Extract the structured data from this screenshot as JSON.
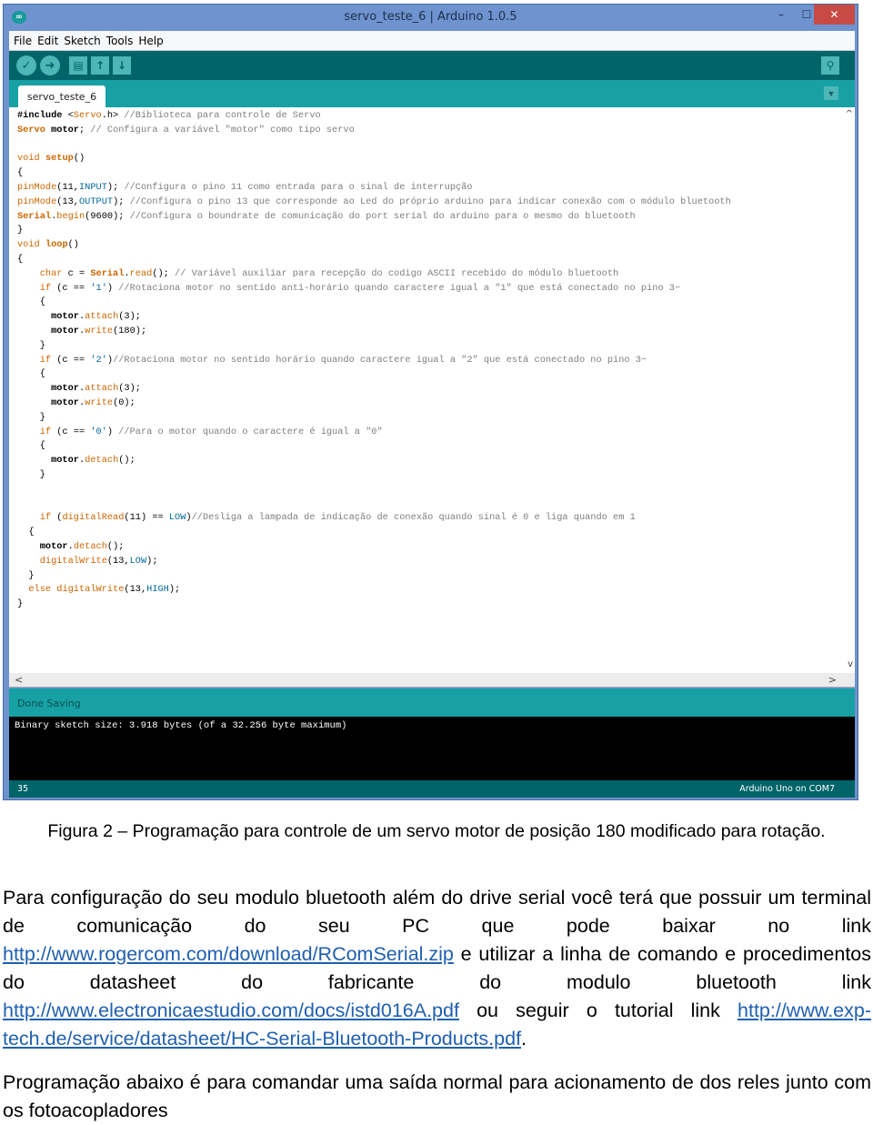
{
  "window": {
    "title": "servo_teste_6 | Arduino 1.0.5",
    "logo_glyph": "∞",
    "controls": {
      "minimize": "–",
      "maximize": "☐",
      "close": "✕"
    }
  },
  "menubar": {
    "items": [
      "File",
      "Edit",
      "Sketch",
      "Tools",
      "Help"
    ]
  },
  "toolbar": {
    "buttons": [
      {
        "name": "verify",
        "glyph": "✓"
      },
      {
        "name": "upload",
        "glyph": "➜"
      },
      {
        "name": "new",
        "glyph": "▤"
      },
      {
        "name": "open",
        "glyph": "↑"
      },
      {
        "name": "save",
        "glyph": "↓"
      }
    ],
    "serial_monitor_glyph": "⚲"
  },
  "tabs": {
    "active": "servo_teste_6",
    "menu_glyph": "▼"
  },
  "editor": {
    "code_lines": [
      "#include <Servo.h> //Biblioteca para controle de Servo",
      "Servo motor; // Configura a variável \"motor\" como tipo servo",
      "",
      "void setup()",
      "{",
      "pinMode(11,INPUT); //Configura o pino 11 como entrada para o sinal de interrupção",
      "pinMode(13,OUTPUT); //Configura o pino 13 que corresponde ao Led do próprio arduino para indicar conexão com o módulo bluetooth",
      "Serial.begin(9600); //Configura o boundrate de comunicação do port serial do arduino para o mesmo do bluetooth",
      "}",
      "void loop()",
      "{",
      "    char c = Serial.read(); // Variável auxiliar para recepção do codigo ASCII recebido do módulo bluetooth",
      "    if (c == '1') //Rotaciona motor no sentido anti-horário quando caractere igual a \"1\" que está conectado no pino 3~",
      "    {",
      "      motor.attach(3);",
      "      motor.write(180);",
      "    }",
      "    if (c == '2')//Rotaciona motor no sentido horário quando caractere igual a \"2\" que está conectado no pino 3~",
      "    {",
      "      motor.attach(3);",
      "      motor.write(0);",
      "    }",
      "    if (c == '0') //Para o motor quando o caractere é igual a \"0\"",
      "    {",
      "      motor.detach();",
      "    }",
      "",
      "",
      "    if (digitalRead(11) == LOW)//Desliga a lampada de indicação de conexão quando sinal é 0 e liga quando em 1",
      "  {",
      "    motor.detach();",
      "    digitalWrite(13,LOW);",
      "  }",
      "  else digitalWrite(13,HIGH);",
      "}"
    ],
    "scroll_up": "^",
    "scroll_down": "v",
    "scroll_left": "<",
    "scroll_right": ">"
  },
  "status": {
    "message": "Done Saving"
  },
  "console": {
    "output": "Binary sketch size: 3.918 bytes (of a 32.256 byte maximum)"
  },
  "footer": {
    "line_number": "35",
    "board": "Arduino Uno on COM7"
  },
  "document": {
    "caption": "Figura 2 – Programação para controle de um servo motor de posição 180 modificado para rotação.",
    "paragraph1": {
      "text_a": "Para configuração do seu modulo bluetooth além do drive serial você terá que possuir um terminal de comunicação do seu PC que pode baixar no link ",
      "link1": "http://www.rogercom.com/download/RComSerial.zip",
      "text_b": " e utilizar a linha de comando e procedimentos do datasheet do fabricante do modulo bluetooth link ",
      "link2": "http://www.electronicaestudio.com/docs/istd016A.pdf",
      "text_c": " ou seguir o tutorial link ",
      "link3": "http://www.exp-tech.de/service/datasheet/HC-Serial-Bluetooth-Products.pdf",
      "text_d": "."
    },
    "paragraph2": "Programação abaixo é para comandar uma saída normal para acionamento de dos reles junto com os fotoacopladores"
  },
  "colors": {
    "titlebar": "#6e93cf",
    "toolbar": "#006468",
    "tabbar": "#17a1a5",
    "close": "#c84a45",
    "link": "#1f5fb0"
  }
}
